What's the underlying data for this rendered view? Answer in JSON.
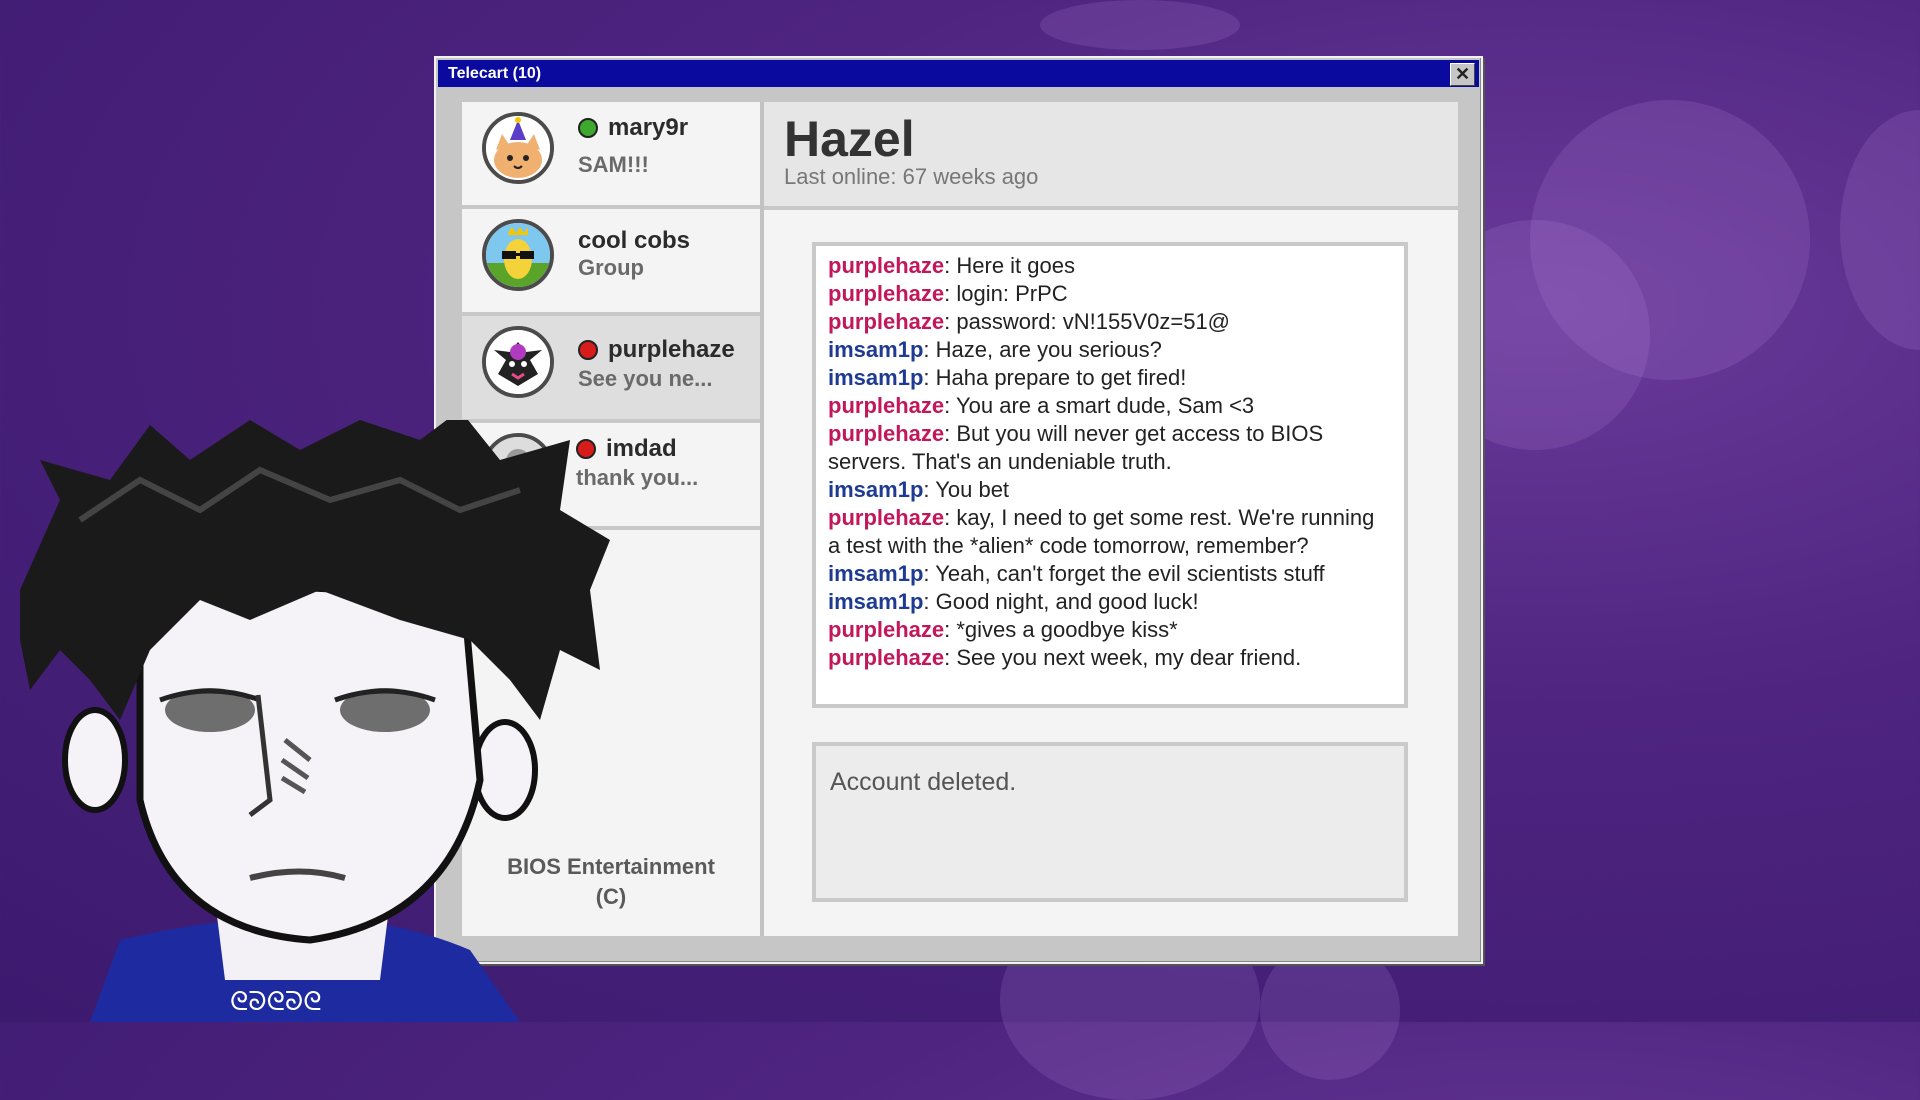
{
  "window": {
    "title": "Telecart (10)",
    "close_label": "✕"
  },
  "contacts": [
    {
      "name": "mary9r",
      "subtitle": "SAM!!!",
      "status": "online",
      "avatar_icon": "party-hat-cat-icon"
    },
    {
      "name": "cool cobs",
      "subtitle": "Group",
      "status": "none",
      "avatar_icon": "sunglasses-corn-icon"
    },
    {
      "name": "purplehaze",
      "subtitle": "See you ne...",
      "status": "offline",
      "avatar_icon": "purple-creature-icon",
      "active": true
    },
    {
      "name": "imdad",
      "subtitle": "thank you...",
      "status": "offline",
      "avatar_icon": "default-avatar-icon"
    }
  ],
  "footer": {
    "line1": "BIOS Entertainment",
    "line2": "(C)"
  },
  "chat": {
    "name": "Hazel",
    "last_online": "Last online: 67 weeks ago",
    "messages": [
      {
        "sender": "purplehaze",
        "text": ": Here it goes"
      },
      {
        "sender": "purplehaze",
        "text": ": login: PrPC"
      },
      {
        "sender": "purplehaze",
        "text": ": password: vN!155V0z=51@"
      },
      {
        "sender": "imsam1p",
        "text": ": Haze, are you serious?"
      },
      {
        "sender": "imsam1p",
        "text": ": Haha prepare to get fired!"
      },
      {
        "sender": "purplehaze",
        "text": ": You are a smart dude, Sam <3"
      },
      {
        "sender": "purplehaze",
        "text": ": But you will never get access to BIOS servers. That's an undeniable truth."
      },
      {
        "sender": "imsam1p",
        "text": ": You bet"
      },
      {
        "sender": "purplehaze",
        "text": ": kay, I need to get some rest. We're running a test with the *alien* code tomorrow, remember?"
      },
      {
        "sender": "imsam1p",
        "text": ": Yeah, can't forget the evil scientists stuff"
      },
      {
        "sender": "imsam1p",
        "text": ": Good night, and good luck!"
      },
      {
        "sender": "purplehaze",
        "text": ": *gives a goodbye kiss*"
      },
      {
        "sender": "purplehaze",
        "text": ": See you next week, my dear friend."
      }
    ],
    "input_text": "Account deleted."
  },
  "colors": {
    "purplehaze": "#c2185b",
    "imsam1p": "#1f3a93",
    "titlebar": "#0a0a9e",
    "background": "#4e2480"
  }
}
